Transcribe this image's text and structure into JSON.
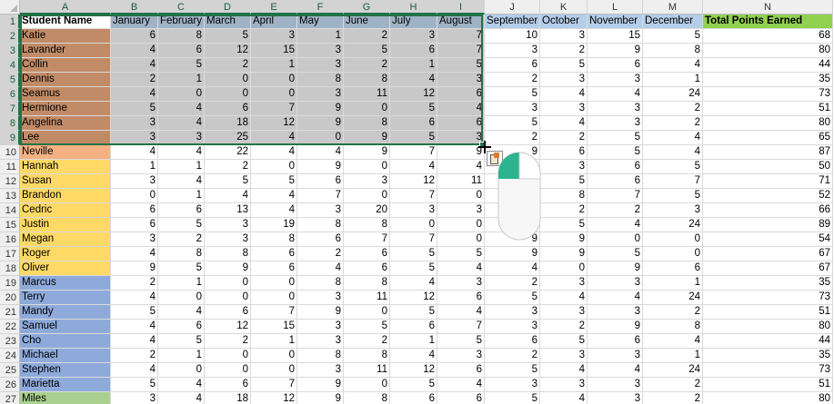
{
  "sheet": {
    "columns": [
      "A",
      "B",
      "C",
      "D",
      "E",
      "F",
      "G",
      "H",
      "I",
      "J",
      "K",
      "L",
      "M",
      "N"
    ],
    "rows": [
      [
        "Student Name",
        "January",
        "February",
        "March",
        "April",
        "May",
        "June",
        "July",
        "August",
        "September",
        "October",
        "November",
        "December",
        "Total Points Earned"
      ],
      [
        "Katie",
        "6",
        "8",
        "5",
        "3",
        "1",
        "2",
        "3",
        "7",
        "10",
        "3",
        "15",
        "5",
        "68"
      ],
      [
        "Lavander",
        "4",
        "6",
        "12",
        "15",
        "3",
        "5",
        "6",
        "7",
        "3",
        "2",
        "9",
        "8",
        "80"
      ],
      [
        "Collin",
        "4",
        "5",
        "2",
        "1",
        "3",
        "2",
        "1",
        "5",
        "6",
        "5",
        "6",
        "4",
        "44"
      ],
      [
        "Dennis",
        "2",
        "1",
        "0",
        "0",
        "8",
        "8",
        "4",
        "3",
        "2",
        "3",
        "3",
        "1",
        "35"
      ],
      [
        "Seamus",
        "4",
        "0",
        "0",
        "0",
        "3",
        "11",
        "12",
        "6",
        "5",
        "4",
        "4",
        "24",
        "73"
      ],
      [
        "Hermione",
        "5",
        "4",
        "6",
        "7",
        "9",
        "0",
        "5",
        "4",
        "3",
        "3",
        "3",
        "2",
        "51"
      ],
      [
        "Angelina",
        "3",
        "4",
        "18",
        "12",
        "9",
        "8",
        "6",
        "6",
        "5",
        "4",
        "3",
        "2",
        "80"
      ],
      [
        "Lee",
        "3",
        "3",
        "25",
        "4",
        "0",
        "9",
        "5",
        "3",
        "2",
        "2",
        "5",
        "4",
        "65"
      ],
      [
        "Neville",
        "4",
        "4",
        "22",
        "4",
        "4",
        "9",
        "7",
        "9",
        "9",
        "6",
        "5",
        "4",
        "87"
      ],
      [
        "Hannah",
        "1",
        "1",
        "2",
        "0",
        "9",
        "0",
        "4",
        "4",
        "",
        "3",
        "6",
        "5",
        "50"
      ],
      [
        "Susan",
        "3",
        "4",
        "5",
        "5",
        "6",
        "3",
        "12",
        "11",
        "",
        "5",
        "6",
        "7",
        "71"
      ],
      [
        "Brandon",
        "0",
        "1",
        "4",
        "4",
        "7",
        "0",
        "7",
        "0",
        "",
        "8",
        "7",
        "5",
        "52"
      ],
      [
        "Cedric",
        "6",
        "6",
        "13",
        "4",
        "3",
        "20",
        "3",
        "3",
        "",
        "2",
        "2",
        "3",
        "66"
      ],
      [
        "Justin",
        "6",
        "5",
        "3",
        "19",
        "8",
        "8",
        "0",
        "0",
        "",
        "5",
        "4",
        "24",
        "89"
      ],
      [
        "Megan",
        "3",
        "2",
        "3",
        "8",
        "6",
        "7",
        "7",
        "0",
        "9",
        "9",
        "0",
        "0",
        "54"
      ],
      [
        "Roger",
        "4",
        "8",
        "8",
        "6",
        "2",
        "6",
        "5",
        "5",
        "9",
        "9",
        "5",
        "0",
        "67"
      ],
      [
        "Oliver",
        "9",
        "5",
        "9",
        "6",
        "4",
        "6",
        "5",
        "4",
        "4",
        "0",
        "9",
        "6",
        "67"
      ],
      [
        "Marcus",
        "2",
        "1",
        "0",
        "0",
        "8",
        "8",
        "4",
        "3",
        "2",
        "3",
        "3",
        "1",
        "35"
      ],
      [
        "Terry",
        "4",
        "0",
        "0",
        "0",
        "3",
        "11",
        "12",
        "6",
        "5",
        "4",
        "4",
        "24",
        "73"
      ],
      [
        "Mandy",
        "5",
        "4",
        "6",
        "7",
        "9",
        "0",
        "5",
        "4",
        "3",
        "3",
        "3",
        "2",
        "51"
      ],
      [
        "Samuel",
        "4",
        "6",
        "12",
        "15",
        "3",
        "5",
        "6",
        "7",
        "3",
        "2",
        "9",
        "8",
        "80"
      ],
      [
        "Cho",
        "4",
        "5",
        "2",
        "1",
        "3",
        "2",
        "1",
        "5",
        "6",
        "5",
        "6",
        "4",
        "44"
      ],
      [
        "Michael",
        "2",
        "1",
        "0",
        "0",
        "8",
        "8",
        "4",
        "3",
        "2",
        "3",
        "3",
        "1",
        "35"
      ],
      [
        "Stephen",
        "4",
        "0",
        "0",
        "0",
        "3",
        "11",
        "12",
        "6",
        "5",
        "4",
        "4",
        "24",
        "73"
      ],
      [
        "Marietta",
        "5",
        "4",
        "6",
        "7",
        "9",
        "0",
        "5",
        "4",
        "3",
        "3",
        "3",
        "2",
        "51"
      ],
      [
        "Miles",
        "3",
        "4",
        "18",
        "12",
        "9",
        "8",
        "6",
        "6",
        "5",
        "4",
        "3",
        "2",
        "80"
      ]
    ]
  },
  "colors": {
    "header_month_blue": "#b4cde8",
    "total_header_green": "#92d050",
    "name_brown": "#c18b67",
    "name_orange": "#f4b183",
    "name_yellow": "#ffd966",
    "name_blue": "#8eaadb",
    "name_green": "#a9d08e",
    "selection_gray": "#c8c8c8",
    "selection_border": "#217346"
  },
  "icons": {
    "paste_options": "paste-options-icon",
    "mouse": "mouse-icon",
    "cursor": "crosshair-cursor-icon"
  }
}
